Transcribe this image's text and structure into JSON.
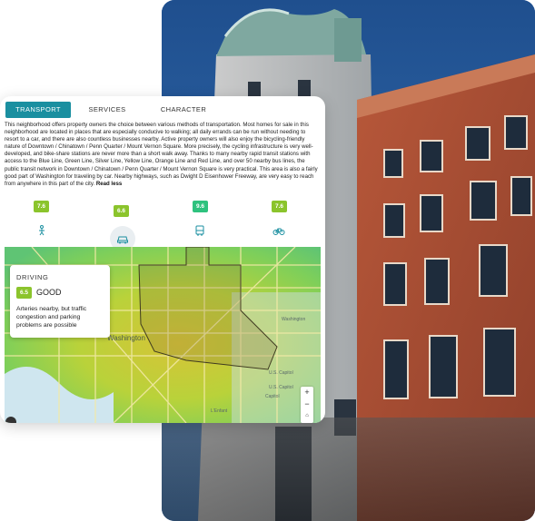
{
  "tabs": [
    {
      "label": "TRANSPORT",
      "active": true
    },
    {
      "label": "SERVICES",
      "active": false
    },
    {
      "label": "CHARACTER",
      "active": false
    }
  ],
  "description": {
    "text": "This neighborhood offers property owners the choice between various methods of transportation. Most homes for sale in this neighborhood are located in places that are especially conducive to walking; all daily errands can be run without needing to resort to a car, and there are also countless businesses nearby. Active property owners will also enjoy the bicycling-friendly nature of Downtown / Chinatown / Penn Quarter / Mount Vernon Square. More precisely, the cycling infrastructure is very well-developed, and bike-share stations are never more than a short walk away. Thanks to many nearby rapid transit stations with access to the Blue Line, Green Line, Silver Line, Yellow Line, Orange Line and Red Line, and over 50 nearby bus lines, the public transit network in Downtown / Chinatown / Penn Quarter / Mount Vernon Square is very practical. This area is also a fairly good part of Washington for traveling by car. Nearby highways, such as Dwight D Eisenhower Freeway, are very easy to reach from anywhere in this part of the city.",
    "read_less": "Read less"
  },
  "modes": [
    {
      "name": "walking",
      "score": "7.6",
      "icon": "pedestrian-icon",
      "color": "#8bc42c"
    },
    {
      "name": "driving",
      "score": "6.6",
      "icon": "car-icon",
      "color": "#8bc42c",
      "selected": true
    },
    {
      "name": "transit",
      "score": "9.6",
      "icon": "bus-icon",
      "color": "#2ec27e"
    },
    {
      "name": "cycling",
      "score": "7.6",
      "icon": "bicycle-icon",
      "color": "#8bc42c"
    }
  ],
  "popup": {
    "title": "DRIVING",
    "score": "6.5",
    "rating": "GOOD",
    "text": "Arteries nearby, but traffic congestion and parking problems are possible"
  },
  "map_labels": {
    "city": "Washington",
    "east": "Washington",
    "capitol1": "U.S. Capitol",
    "capitol2": "U.S. Capitol",
    "capitol3": "Capitol",
    "enfant": "L'Enfant"
  },
  "zoom": {
    "in": "+",
    "out": "−",
    "reset": "⌂"
  },
  "colors": {
    "accent": "#1a8fa0",
    "score_good": "#8bc42c",
    "score_excellent": "#2ec27e"
  }
}
